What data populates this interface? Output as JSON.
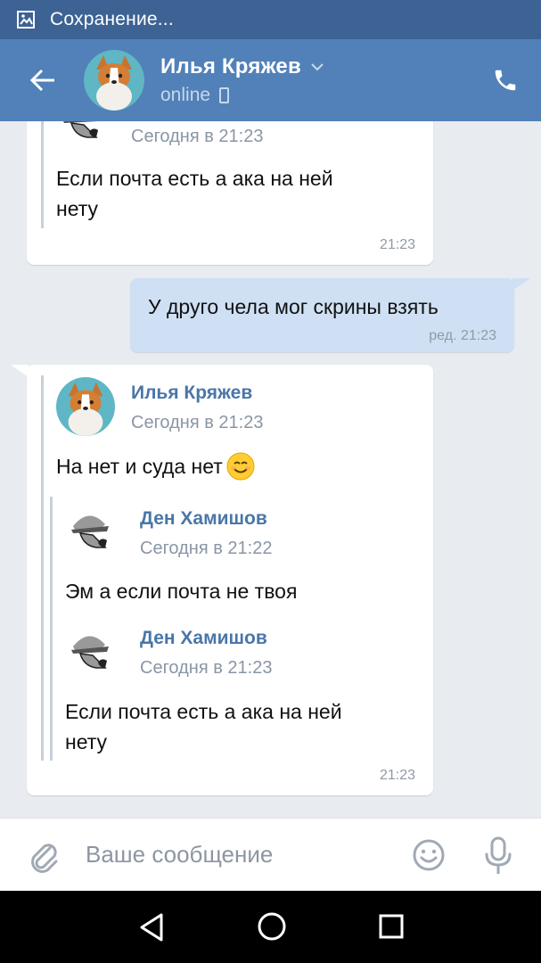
{
  "status_bar": {
    "text": "Сохранение...",
    "icon": "image-save-icon"
  },
  "header": {
    "contact_name": "Илья Кряжев",
    "presence": "online",
    "back_icon": "arrow-left-icon",
    "call_icon": "phone-icon"
  },
  "messages": [
    {
      "id": "m1",
      "direction": "incoming",
      "forwarded_tail": {
        "date": "Сегодня в 21:23",
        "text_line1": "Если почта есть а ака на ней",
        "text_line2": "нету"
      },
      "time": "21:23"
    },
    {
      "id": "m2",
      "direction": "outgoing",
      "text": "У друго чела мог скрины взять",
      "meta": "ред. 21:23"
    },
    {
      "id": "m3",
      "direction": "incoming",
      "forwarded": {
        "author": "Илья Кряжев",
        "date": "Сегодня в 21:23",
        "text": "На нет и суда нет",
        "emoji": "smiling-face",
        "nested": [
          {
            "author": "Ден Хамишов",
            "date": "Сегодня в 21:22",
            "text": "Эм а если почта не твоя"
          },
          {
            "author": "Ден Хамишов",
            "date": "Сегодня в 21:23",
            "text_line1": "Если почта есть а ака на ней",
            "text_line2": "нету"
          }
        ]
      },
      "time": "21:23"
    }
  ],
  "composer": {
    "placeholder": "Ваше сообщение",
    "attach_icon": "paperclip-icon",
    "emoji_icon": "smile-icon",
    "mic_icon": "microphone-icon"
  },
  "colors": {
    "header": "#5181b8",
    "statusbar": "#3d6394",
    "background": "#e8ebef",
    "outgoing_bubble": "#cfe0f4",
    "author_link": "#4a76a8"
  }
}
